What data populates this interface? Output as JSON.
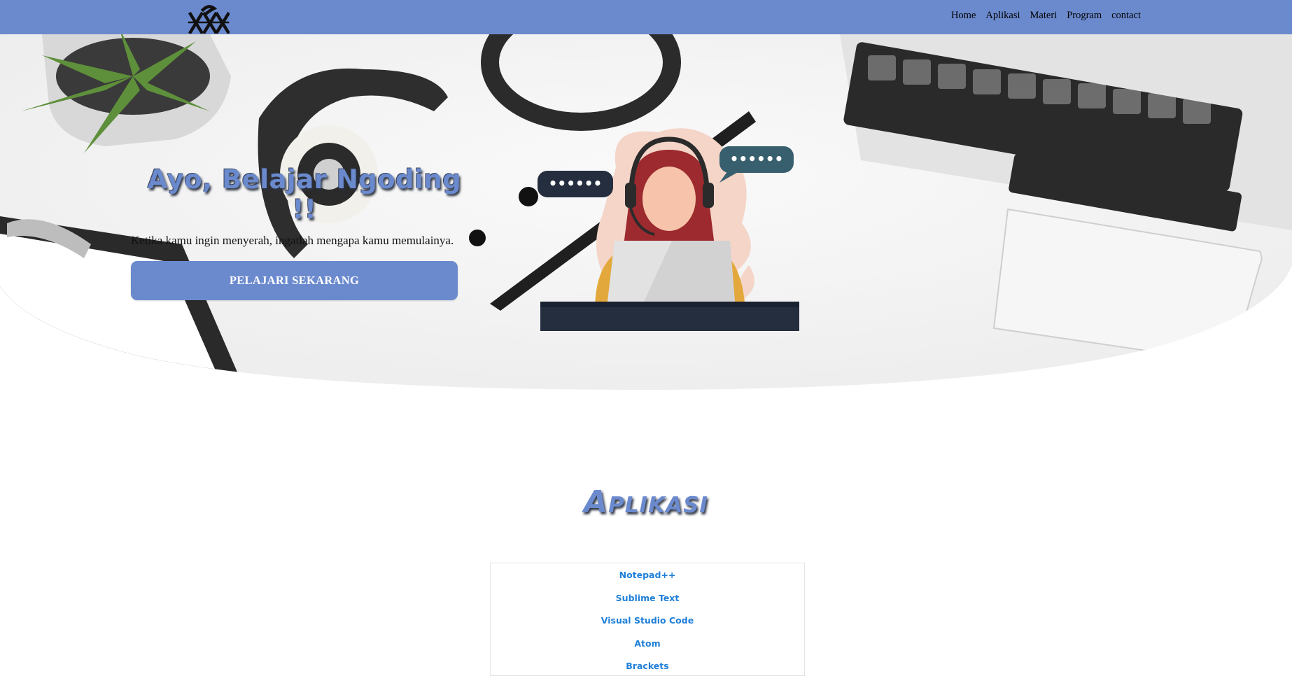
{
  "nav": {
    "logo_icon": "kxn-monogram-logo",
    "links": [
      "Home",
      "Aplikasi",
      "Materi",
      "Program",
      "contact"
    ]
  },
  "hero": {
    "title": "Ayo, Belajar Ngoding !!",
    "subtitle": "Ketika kamu ingin menyerah, ingatlah mengapa kamu memulainya.",
    "button_label": "PELAJARI SEKARANG",
    "bubble_left": "••••••",
    "bubble_right": "••••••"
  },
  "aplikasi": {
    "title": "Aplikasi",
    "items": [
      "Notepad++",
      "Sublime Text",
      "Visual Studio Code",
      "Atom",
      "Brackets"
    ]
  },
  "colors": {
    "brand": "#6b8ace",
    "link": "#1e7fd8"
  }
}
